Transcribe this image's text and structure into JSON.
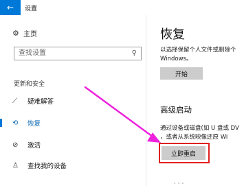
{
  "window": {
    "back_glyph": "←",
    "title": "设置"
  },
  "sidebar": {
    "home_label": "主页",
    "search_placeholder": "查找设置",
    "section_label": "更新和安全",
    "items": [
      {
        "icon": "wrench-icon",
        "glyph": "⚲",
        "label": "疑难解答"
      },
      {
        "icon": "recovery-icon",
        "glyph": "⟲",
        "label": "恢复"
      },
      {
        "icon": "activation-icon",
        "glyph": "⊘",
        "label": "激活"
      },
      {
        "icon": "find-device-icon",
        "glyph": "♙",
        "label": "查找我的设备"
      }
    ],
    "active_index": 1
  },
  "main": {
    "title": "恢复",
    "reset_desc_line1": "以选择保留个人文件或删除个",
    "reset_desc_line2": "Windows。",
    "start_button": "开始",
    "advanced_heading": "高级启动",
    "advanced_desc_line1": "通过设备或磁盘(如 U 盘或 DV",
    "advanced_desc_line2": "，或者从系统映像还原 Wi",
    "restart_button": "立即重启"
  },
  "colors": {
    "accent": "#0078d7",
    "annotation_red": "#e02020",
    "annotation_arrow": "#ee22dd"
  }
}
